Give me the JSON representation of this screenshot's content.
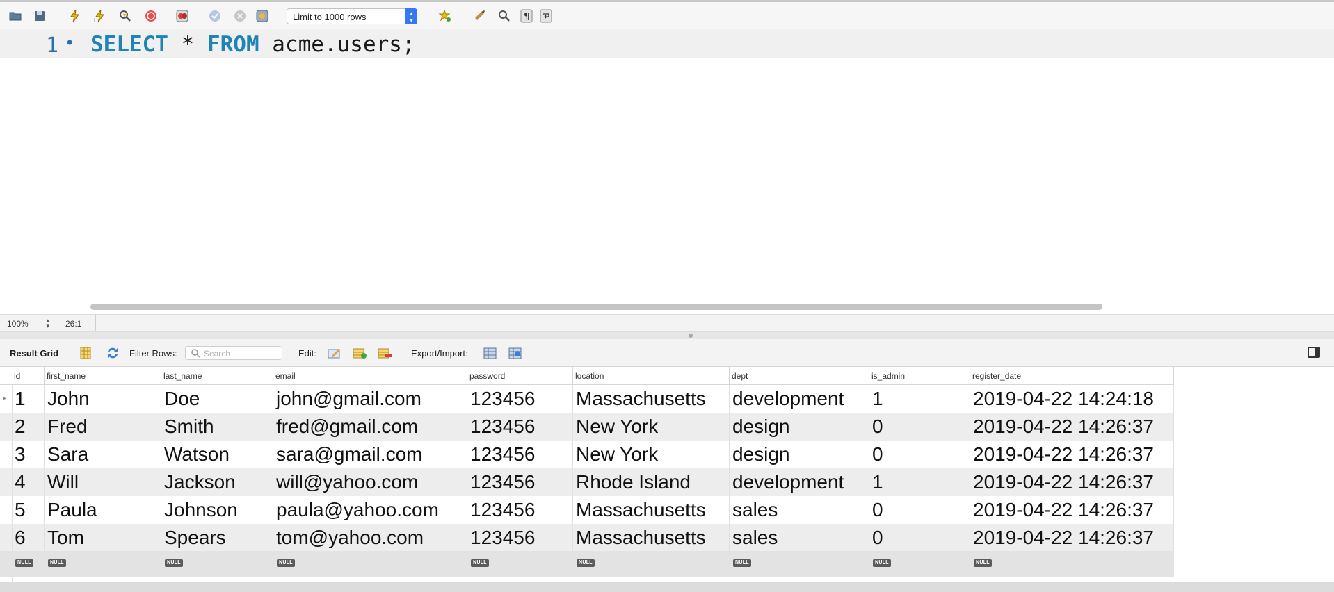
{
  "toolbar": {
    "limit_select_value": "Limit to 1000 rows",
    "icons": [
      "folder-icon",
      "save-icon",
      "execute-icon",
      "execute-current-icon",
      "explain-icon",
      "stop-icon",
      "toggle-error-icon",
      "commit-icon",
      "rollback-icon",
      "autocommit-icon",
      "bookmark-icon",
      "beautify-icon",
      "find-icon",
      "invisible-chars-icon",
      "wrap-icon"
    ]
  },
  "editor": {
    "line_number": "1",
    "line_marker": "•",
    "keyword_select": "SELECT",
    "star": " * ",
    "keyword_from": "FROM",
    "rest": " acme.users;"
  },
  "status": {
    "zoom": "100%",
    "cursor_position": "26:1"
  },
  "result_toolbar": {
    "result_grid_label": "Result Grid",
    "filter_rows_label": "Filter Rows:",
    "search_placeholder": "Search",
    "edit_label": "Edit:",
    "export_import_label": "Export/Import:"
  },
  "grid": {
    "columns": [
      "id",
      "first_name",
      "last_name",
      "email",
      "password",
      "location",
      "dept",
      "is_admin",
      "register_date"
    ],
    "rows": [
      [
        "1",
        "John",
        "Doe",
        "john@gmail.com",
        "123456",
        "Massachusetts",
        "development",
        "1",
        "2019-04-22 14:24:18"
      ],
      [
        "2",
        "Fred",
        "Smith",
        "fred@gmail.com",
        "123456",
        "New York",
        "design",
        "0",
        "2019-04-22 14:26:37"
      ],
      [
        "3",
        "Sara",
        "Watson",
        "sara@gmail.com",
        "123456",
        "New York",
        "design",
        "0",
        "2019-04-22 14:26:37"
      ],
      [
        "4",
        "Will",
        "Jackson",
        "will@yahoo.com",
        "123456",
        "Rhode Island",
        "development",
        "1",
        "2019-04-22 14:26:37"
      ],
      [
        "5",
        "Paula",
        "Johnson",
        "paula@yahoo.com",
        "123456",
        "Massachusetts",
        "sales",
        "0",
        "2019-04-22 14:26:37"
      ],
      [
        "6",
        "Tom",
        "Spears",
        "tom@yahoo.com",
        "123456",
        "Massachusetts",
        "sales",
        "0",
        "2019-04-22 14:26:37"
      ]
    ],
    "null_label": "NULL",
    "row_marker": "▸"
  }
}
